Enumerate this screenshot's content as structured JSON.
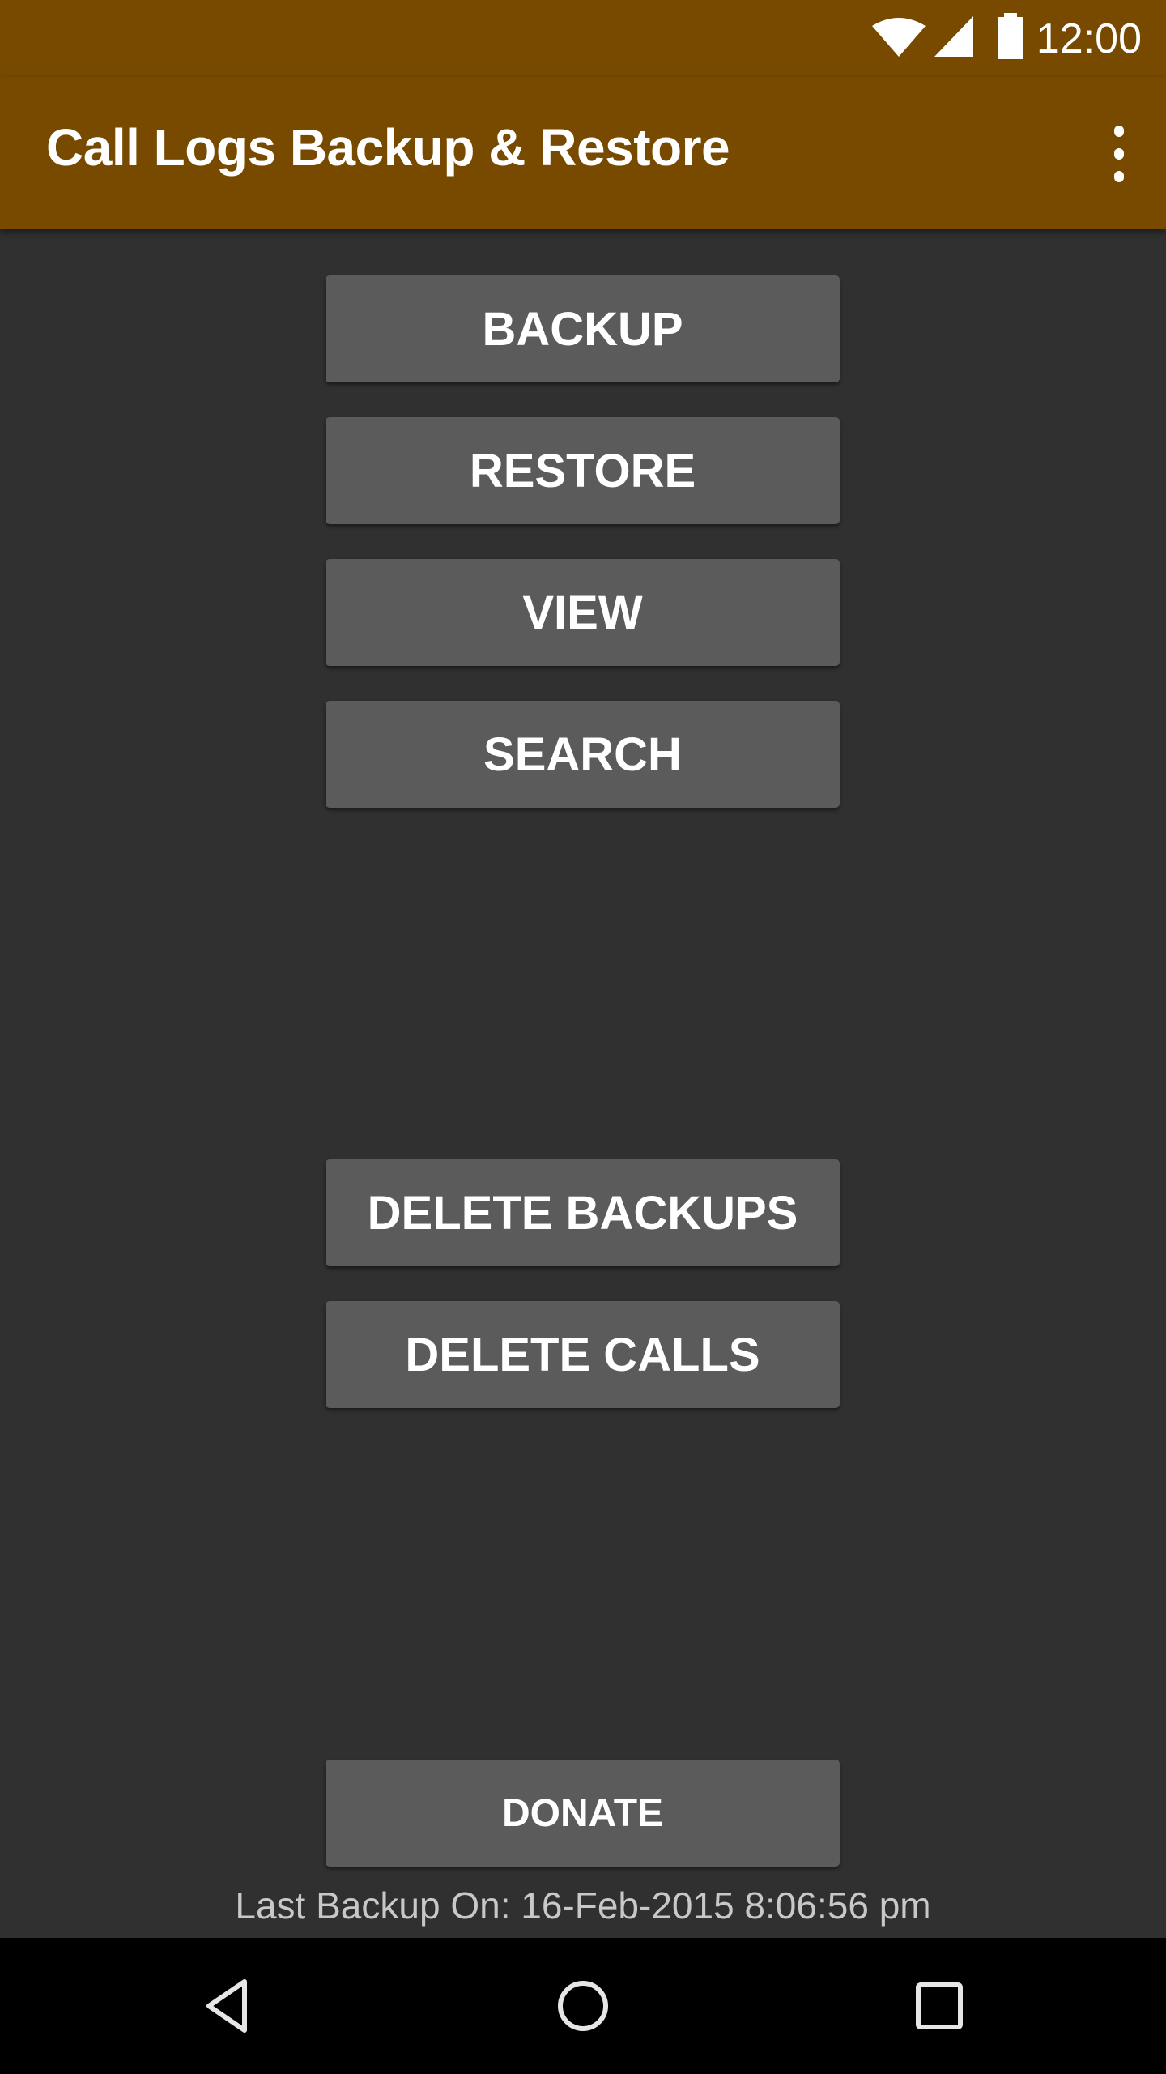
{
  "status_bar": {
    "time": "12:00",
    "icons": [
      "wifi-icon",
      "cell-signal-icon",
      "battery-icon"
    ]
  },
  "app_bar": {
    "title": "Call Logs Backup & Restore",
    "overflow_icon": "more-vert-icon"
  },
  "buttons": {
    "backup": "BACKUP",
    "restore": "RESTORE",
    "view": "VIEW",
    "search": "SEARCH",
    "delete_backups": "DELETE BACKUPS",
    "delete_calls": "DELETE CALLS",
    "donate": "DONATE"
  },
  "last_backup": "Last Backup On: 16-Feb-2015 8:06:56 pm",
  "nav_bar": {
    "icons": [
      "back-icon",
      "home-icon",
      "recents-icon"
    ]
  },
  "colors": {
    "primary": "#774a00",
    "background": "#303030",
    "button": "#5b5b5c"
  }
}
